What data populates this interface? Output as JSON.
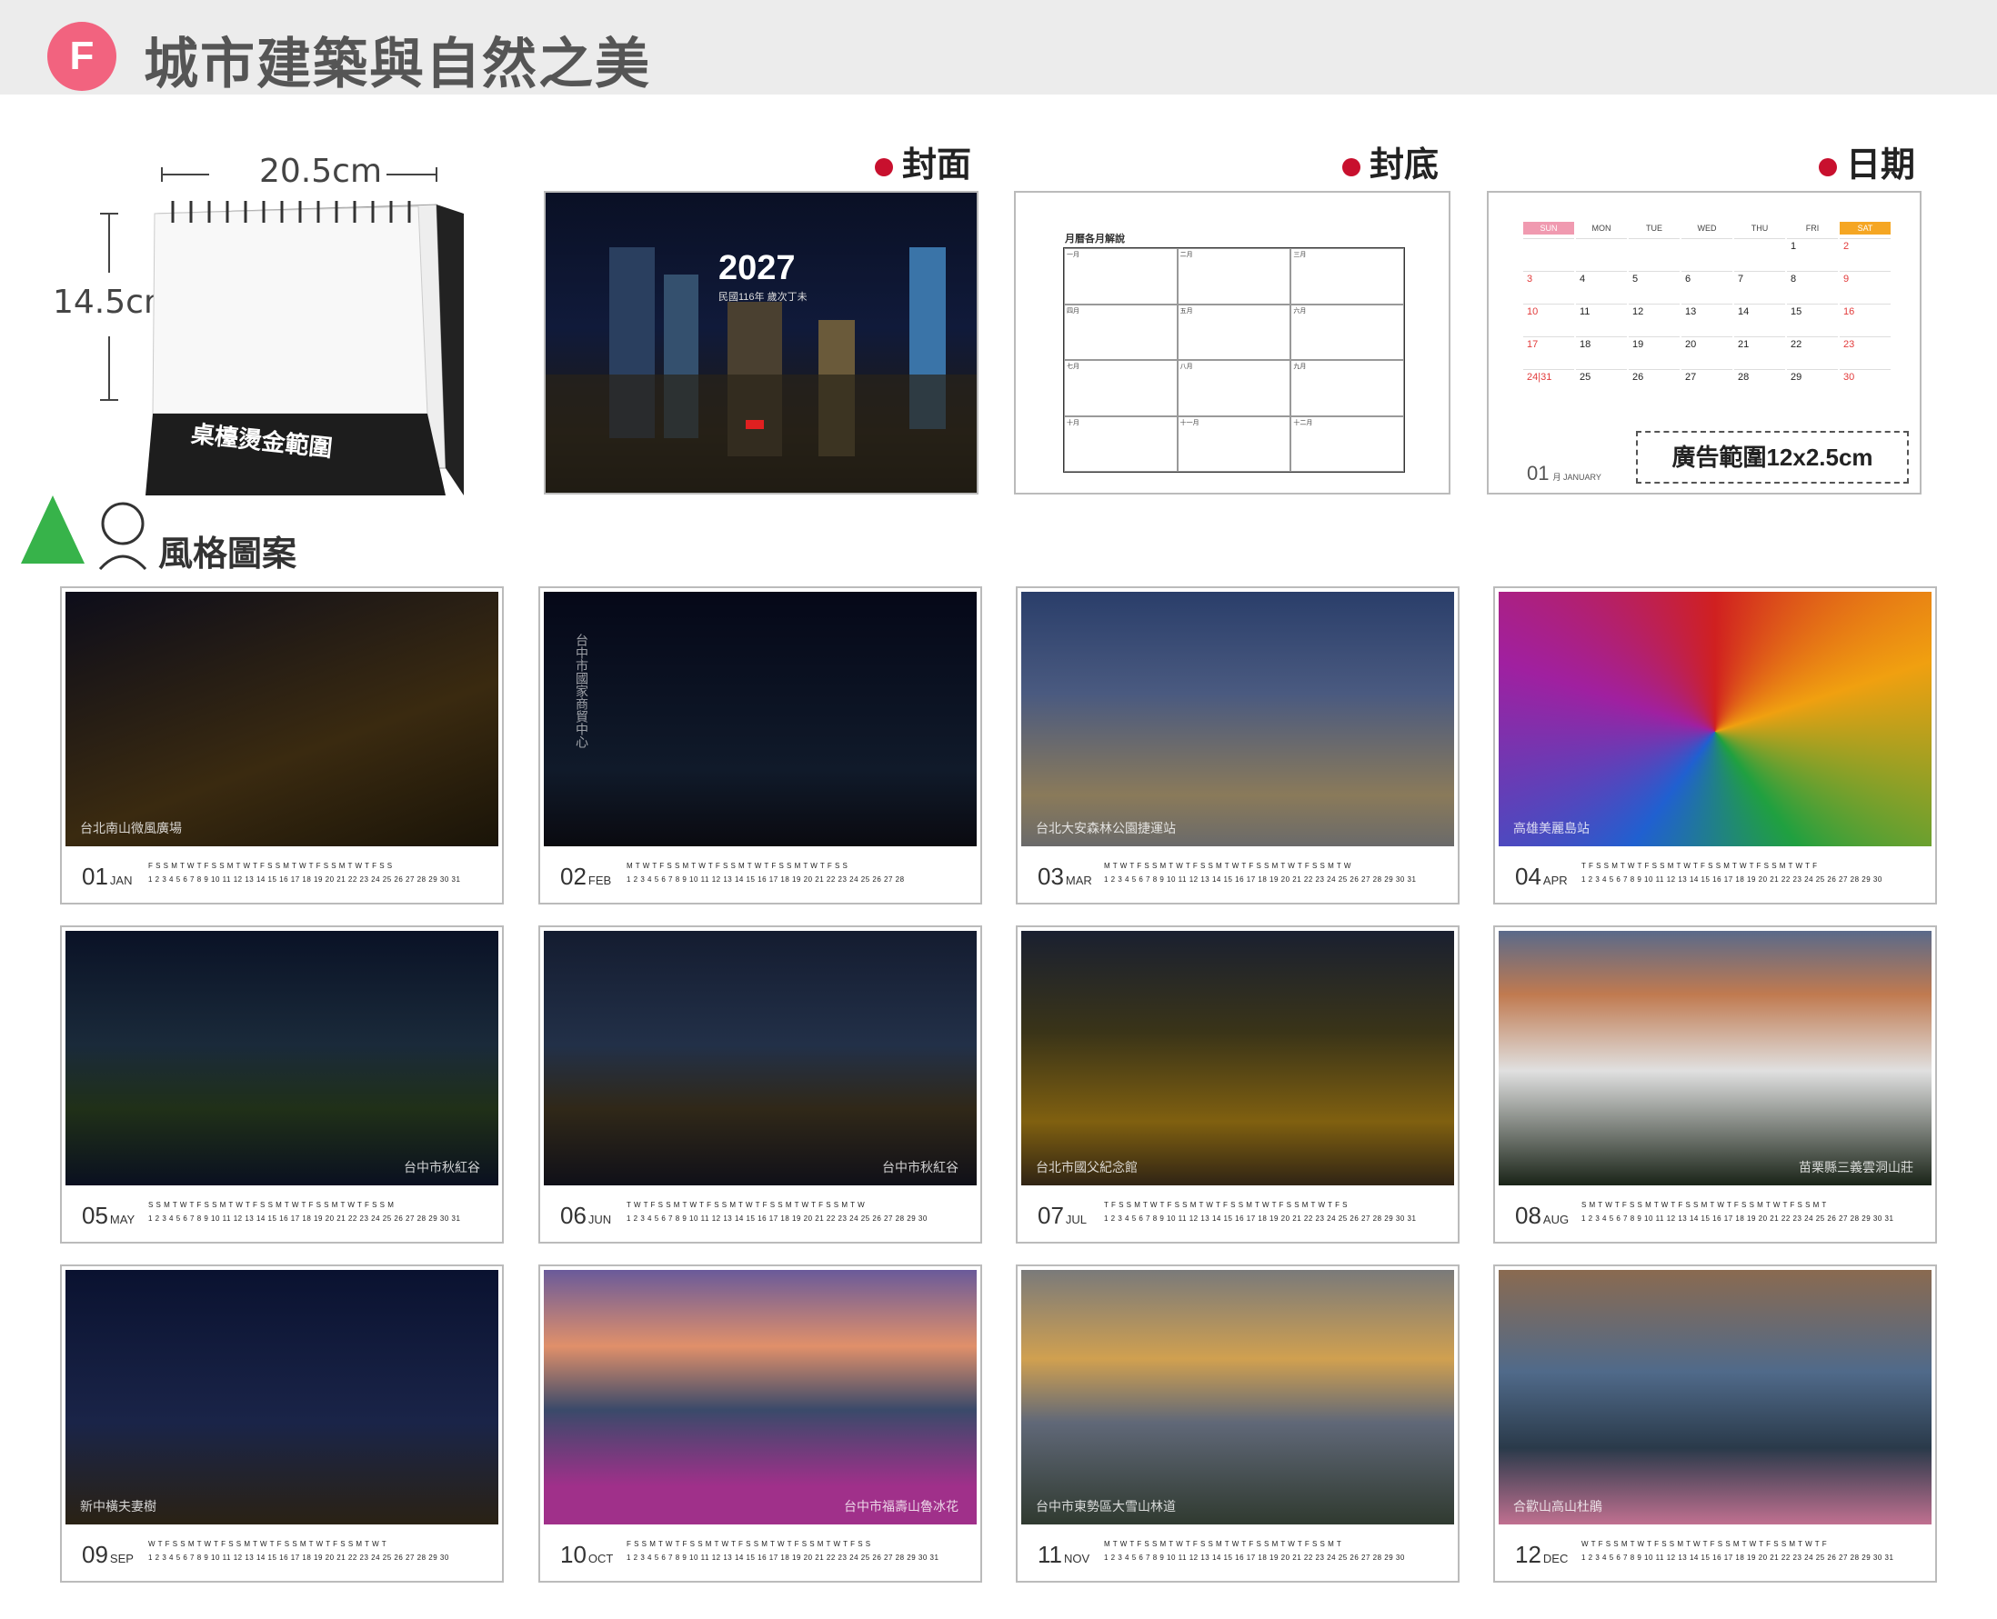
{
  "header": {
    "badge": "F",
    "title": "城市建築與自然之美"
  },
  "product": {
    "width_label": "20.5cm",
    "height_label": "14.5cm",
    "base_label": "桌檯燙金範圍"
  },
  "sections": {
    "cover": "封面",
    "back": "封底",
    "date": "日期",
    "style": "風格圖案"
  },
  "cover": {
    "year": "2027",
    "subtitle": "民國116年 歲次丁未"
  },
  "back_cover": {
    "title": "月曆各月解說",
    "cells": [
      "一月",
      "二月",
      "三月",
      "四月",
      "五月",
      "六月",
      "七月",
      "八月",
      "九月",
      "十月",
      "十一月",
      "十二月"
    ]
  },
  "date_page": {
    "weekdays": [
      "SUN",
      "MON",
      "TUE",
      "WED",
      "THU",
      "FRI",
      "SAT"
    ],
    "weeks": [
      [
        "",
        "",
        "",
        "",
        "",
        "1",
        "2"
      ],
      [
        "3",
        "4",
        "5",
        "6",
        "7",
        "8",
        "9"
      ],
      [
        "10",
        "11",
        "12",
        "13",
        "14",
        "15",
        "16"
      ],
      [
        "17",
        "18",
        "19",
        "20",
        "21",
        "22",
        "23"
      ],
      [
        "24|31",
        "25",
        "26",
        "27",
        "28",
        "29",
        "30"
      ]
    ],
    "month_label": "01",
    "month_sub": "月 JANUARY",
    "ad_label": "廣告範圍12x2.5cm"
  },
  "months": [
    {
      "num": "01",
      "abbr": "JAN",
      "caption": "台北南山微風廣場",
      "dow": "F S S M T W T F S S M T W T F S S M T W T F S S M T W T F S S",
      "days": "1 2 3 4 5 6 7 8 9 10 11 12 13 14 15 16 17 18 19 20 21 22 23 24 25 26 27 28 29 30 31"
    },
    {
      "num": "02",
      "abbr": "FEB",
      "caption": "台中市國家商貿中心",
      "dow": "M T W T F S S M T W T F S S M T W T F S S M T W T F S S",
      "days": "1 2 3 4 5 6 7 8 9 10 11 12 13 14 15 16 17 18 19 20 21 22 23 24 25 26 27 28"
    },
    {
      "num": "03",
      "abbr": "MAR",
      "caption": "台北大安森林公園捷運站",
      "dow": "M T W T F S S M T W T F S S M T W T F S S M T W T F S S M T W",
      "days": "1 2 3 4 5 6 7 8 9 10 11 12 13 14 15 16 17 18 19 20 21 22 23 24 25 26 27 28 29 30 31"
    },
    {
      "num": "04",
      "abbr": "APR",
      "caption": "高雄美麗島站",
      "dow": "T F S S M T W T F S S M T W T F S S M T W T F S S M T W T F",
      "days": "1 2 3 4 5 6 7 8 9 10 11 12 13 14 15 16 17 18 19 20 21 22 23 24 25 26 27 28 29 30"
    },
    {
      "num": "05",
      "abbr": "MAY",
      "caption": "台中市秋紅谷",
      "dow": "S S M T W T F S S M T W T F S S M T W T F S S M T W T F S S M",
      "days": "1 2 3 4 5 6 7 8 9 10 11 12 13 14 15 16 17 18 19 20 21 22 23 24 25 26 27 28 29 30 31"
    },
    {
      "num": "06",
      "abbr": "JUN",
      "caption": "台中市秋紅谷",
      "dow": "T W T F S S M T W T F S S M T W T F S S M T W T F S S M T W",
      "days": "1 2 3 4 5 6 7 8 9 10 11 12 13 14 15 16 17 18 19 20 21 22 23 24 25 26 27 28 29 30"
    },
    {
      "num": "07",
      "abbr": "JUL",
      "caption": "台北市國父紀念館",
      "dow": "T F S S M T W T F S S M T W T F S S M T W T F S S M T W T F S",
      "days": "1 2 3 4 5 6 7 8 9 10 11 12 13 14 15 16 17 18 19 20 21 22 23 24 25 26 27 28 29 30 31"
    },
    {
      "num": "08",
      "abbr": "AUG",
      "caption": "苗栗縣三義雲洞山莊",
      "dow": "S M T W T F S S M T W T F S S M T W T F S S M T W T F S S M T",
      "days": "1 2 3 4 5 6 7 8 9 10 11 12 13 14 15 16 17 18 19 20 21 22 23 24 25 26 27 28 29 30 31"
    },
    {
      "num": "09",
      "abbr": "SEP",
      "caption": "新中橫夫妻樹",
      "dow": "W T F S S M T W T F S S M T W T F S S M T W T F S S M T W T",
      "days": "1 2 3 4 5 6 7 8 9 10 11 12 13 14 15 16 17 18 19 20 21 22 23 24 25 26 27 28 29 30"
    },
    {
      "num": "10",
      "abbr": "OCT",
      "caption": "台中市福壽山魯冰花",
      "dow": "F S S M T W T F S S M T W T F S S M T W T F S S M T W T F S S",
      "days": "1 2 3 4 5 6 7 8 9 10 11 12 13 14 15 16 17 18 19 20 21 22 23 24 25 26 27 28 29 30 31"
    },
    {
      "num": "11",
      "abbr": "NOV",
      "caption": "台中市東勢區大雪山林道",
      "dow": "M T W T F S S M T W T F S S M T W T F S S M T W T F S S M T",
      "days": "1 2 3 4 5 6 7 8 9 10 11 12 13 14 15 16 17 18 19 20 21 22 23 24 25 26 27 28 29 30"
    },
    {
      "num": "12",
      "abbr": "DEC",
      "caption": "合歡山高山杜鵑",
      "dow": "W T F S S M T W T F S S M T W T F S S M T W T F S S M T W T F",
      "days": "1 2 3 4 5 6 7 8 9 10 11 12 13 14 15 16 17 18 19 20 21 22 23 24 25 26 27 28 29 30 31"
    }
  ],
  "colors": {
    "badge": "#f2637f",
    "dot": "#c8102e",
    "accent_red": "#e23b3b",
    "sat": "#f5a623",
    "sun": "#f09ab0"
  }
}
